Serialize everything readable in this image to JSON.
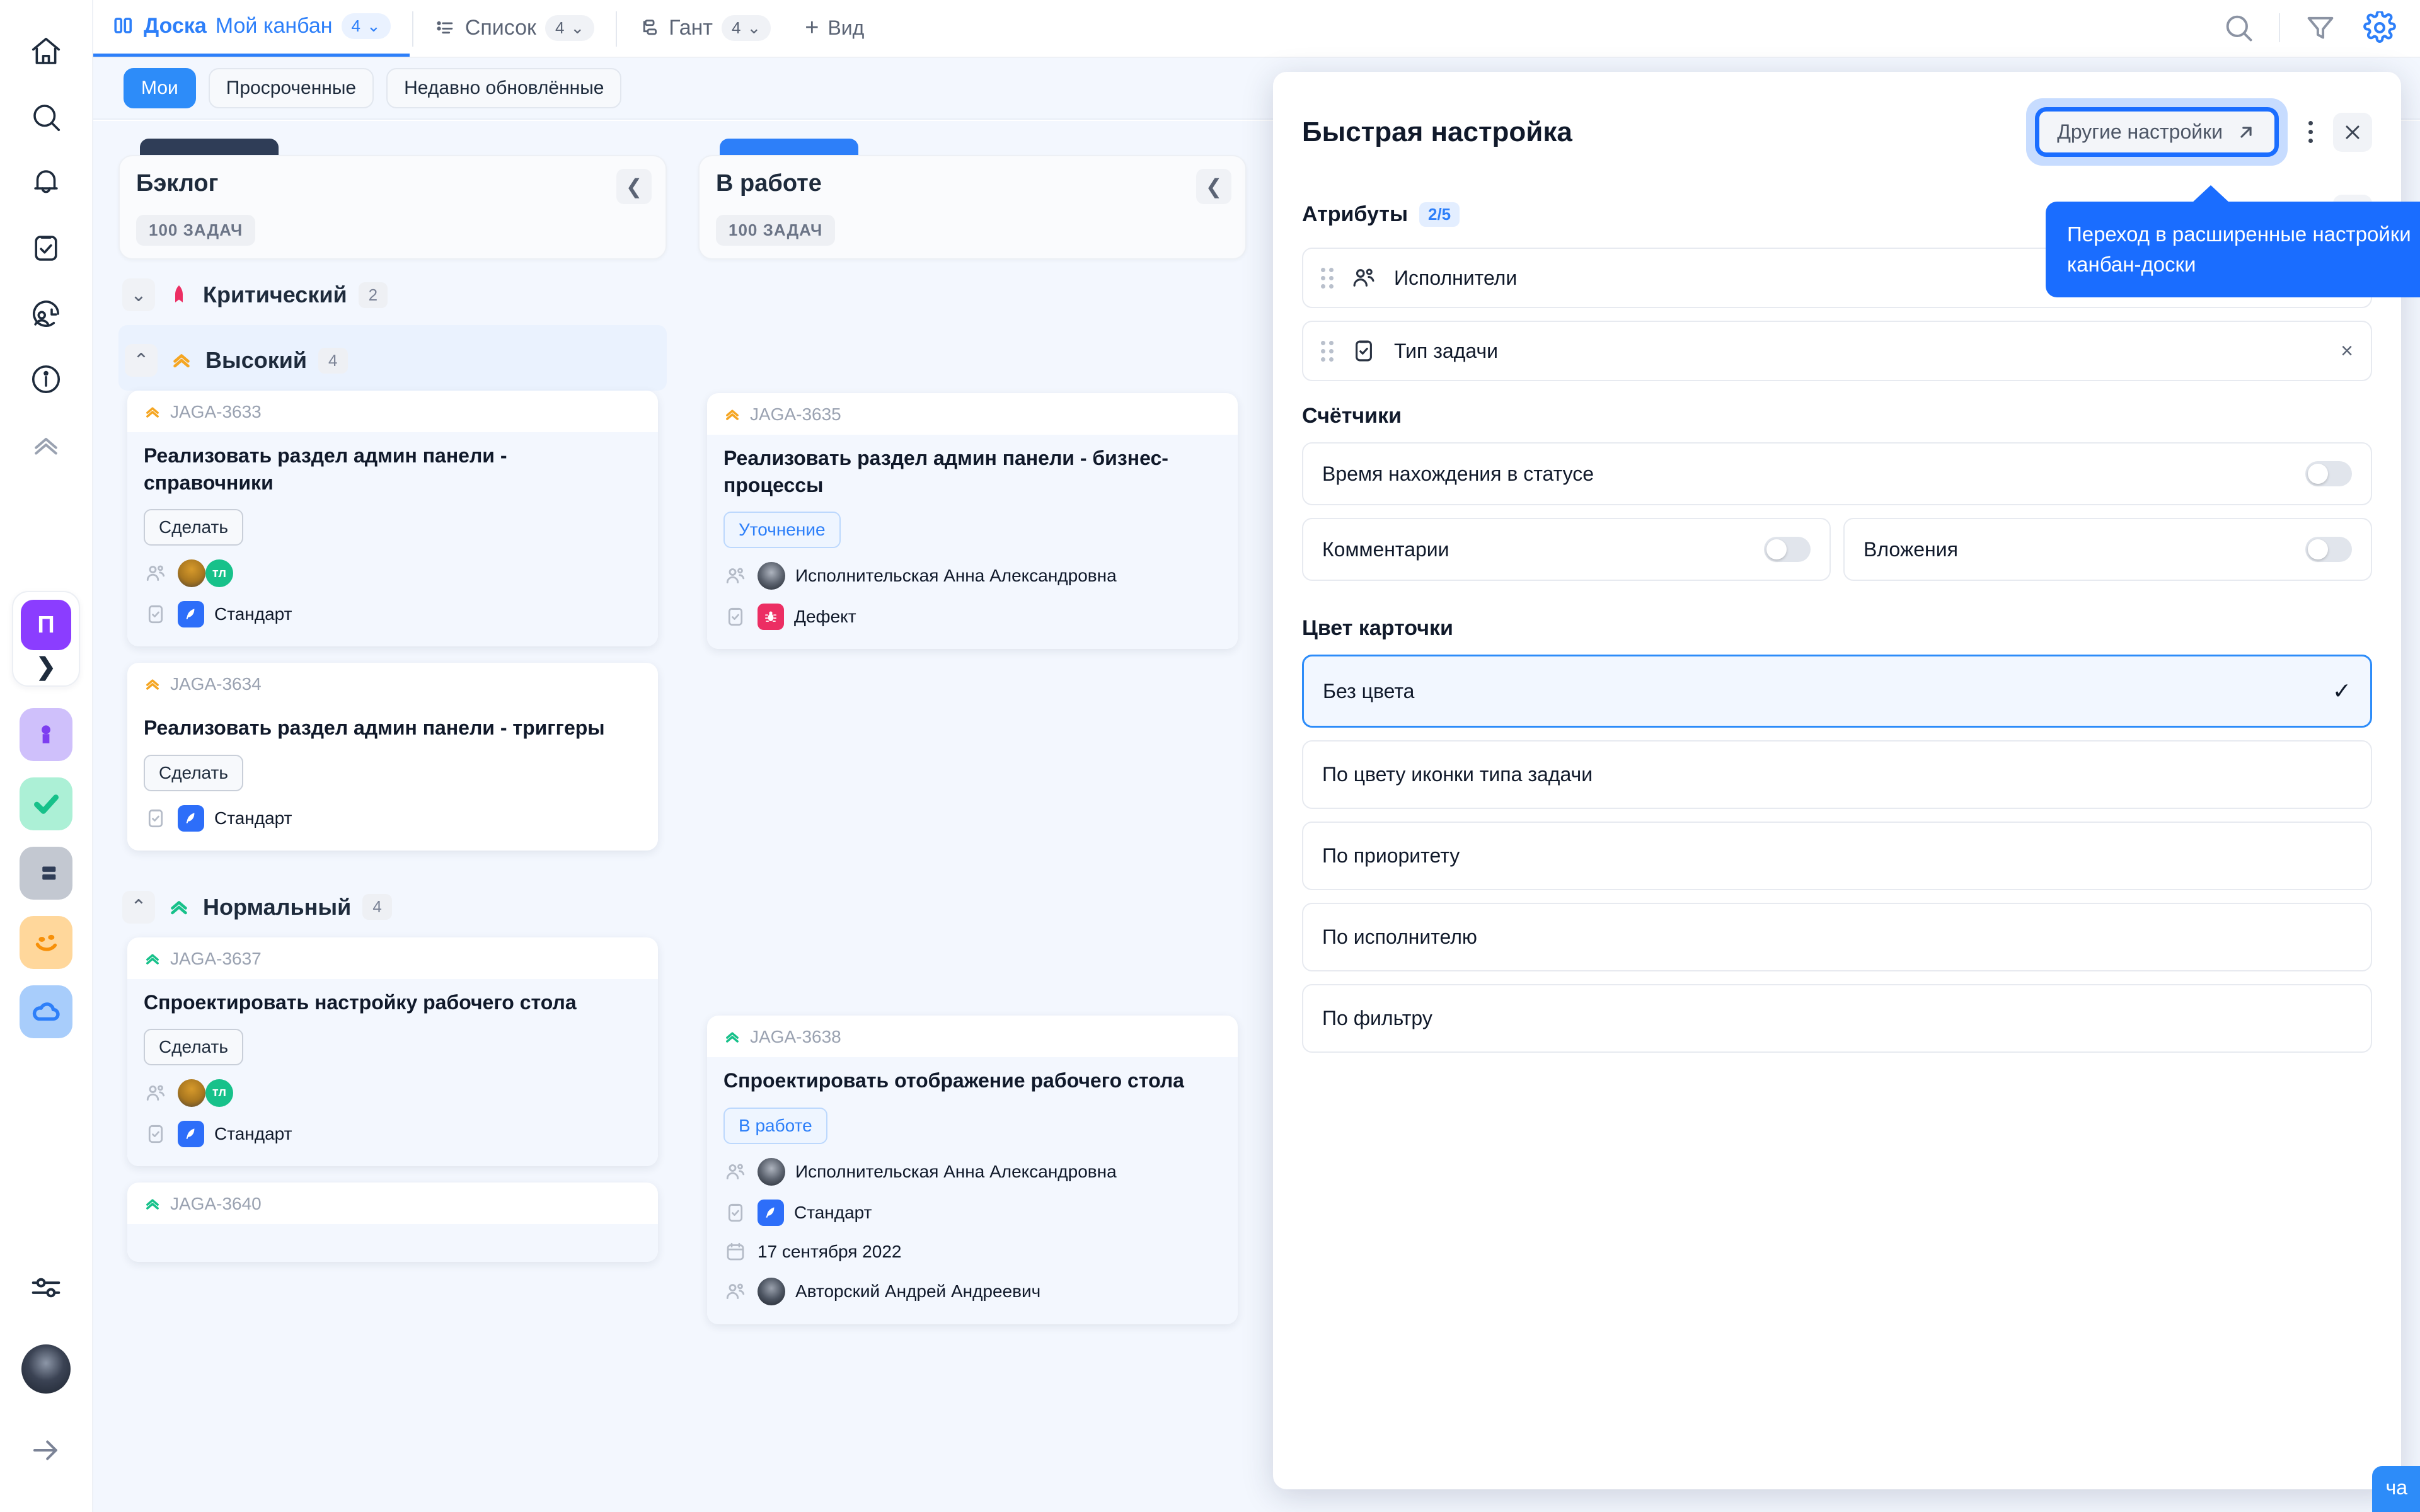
{
  "app": {
    "project_initial": "П",
    "accent": "#2d7ff9",
    "tooltip_blue": "#1a6dff"
  },
  "rail": {
    "icons": [
      {
        "name": "home-icon",
        "label": "Главная"
      },
      {
        "name": "search-icon",
        "label": "Поиск"
      },
      {
        "name": "bell-icon",
        "label": "Уведомления"
      },
      {
        "name": "tasks-icon",
        "label": "Мои задачи"
      },
      {
        "name": "time-tracking-icon",
        "label": "Учёт времени"
      },
      {
        "name": "info-icon",
        "label": "Справка"
      },
      {
        "name": "collapse-up-icon",
        "label": "Свернуть"
      }
    ],
    "apps": [
      {
        "name": "app-tile-person",
        "glyph": ""
      },
      {
        "name": "app-tile-check",
        "glyph": ""
      },
      {
        "name": "app-tile-board",
        "glyph": ""
      },
      {
        "name": "app-tile-smile",
        "glyph": ""
      },
      {
        "name": "app-tile-cloud",
        "glyph": ""
      }
    ],
    "bottom": [
      {
        "name": "sliders-icon",
        "label": "Настройки"
      },
      {
        "name": "avatar",
        "label": "Профиль"
      },
      {
        "name": "arrow-right-icon",
        "label": "Развернуть"
      }
    ]
  },
  "topbar": {
    "tabs": [
      {
        "prefix": "Доска",
        "name": "Мой канбан",
        "count": "4",
        "icon": "board-icon",
        "active": true
      },
      {
        "prefix": "Список",
        "name": "",
        "count": "4",
        "icon": "list-icon",
        "active": false
      },
      {
        "prefix": "Гант",
        "name": "",
        "count": "4",
        "icon": "gantt-icon",
        "active": false
      }
    ],
    "add_view": "Вид",
    "right_icons": [
      {
        "name": "search-icon"
      },
      {
        "name": "filter-icon"
      },
      {
        "name": "gear-icon"
      }
    ]
  },
  "chips": [
    {
      "label": "Мои",
      "active": true
    },
    {
      "label": "Просроченные",
      "active": false
    },
    {
      "label": "Недавно обновлённые",
      "active": false
    }
  ],
  "board": {
    "columns": [
      {
        "title": "Бэклог",
        "count_label": "100 ЗАДАЧ",
        "tab_color": "#2f3d57",
        "groups": [
          {
            "name": "Критический",
            "count": "2",
            "collapsed": true,
            "icon": "priority-critical-icon",
            "color": "#ec2e63",
            "cards": []
          },
          {
            "name": "Высокий",
            "count": "4",
            "collapsed": false,
            "icon": "priority-high-icon",
            "color": "#f5a623",
            "cards": [
              {
                "key": "JAGA-3633",
                "prio_color": "#f5a623",
                "title": "Реализовать раздел админ панели - справочники",
                "status": "Сделать",
                "status_style": "grey",
                "assignees_kind": "avatars",
                "assignee_text": "",
                "type": "Стандарт",
                "type_style": "std",
                "date": "",
                "author": ""
              },
              {
                "key": "JAGA-3634",
                "prio_color": "#f5a623",
                "title": "Реализовать раздел админ панели - триггеры",
                "status": "Сделать",
                "status_style": "grey",
                "assignees_kind": "none",
                "assignee_text": "",
                "type": "Стандарт",
                "type_style": "std",
                "date": "",
                "author": ""
              }
            ]
          },
          {
            "name": "Нормальный",
            "count": "4",
            "collapsed": false,
            "icon": "priority-normal-icon",
            "color": "#17c18a",
            "cards": [
              {
                "key": "JAGA-3637",
                "prio_color": "#17c18a",
                "title": "Спроектировать настройку рабочего стола",
                "status": "Сделать",
                "status_style": "grey",
                "assignees_kind": "avatars",
                "assignee_text": "",
                "type": "Стандарт",
                "type_style": "std",
                "date": "",
                "author": ""
              },
              {
                "key": "JAGA-3640",
                "prio_color": "#17c18a",
                "title": "",
                "status": "",
                "status_style": "grey",
                "assignees_kind": "none",
                "assignee_text": "",
                "type": "",
                "type_style": "std",
                "date": "",
                "author": ""
              }
            ]
          }
        ]
      },
      {
        "title": "В работе",
        "count_label": "100 ЗАДАЧ",
        "tab_color": "#2d7ff9",
        "groups": [
          {
            "name": "",
            "count": "",
            "collapsed": true,
            "icon": "",
            "color": "",
            "cards": []
          },
          {
            "name": "",
            "count": "",
            "collapsed": false,
            "icon": "",
            "color": "#f5a623",
            "cards": [
              {
                "key": "JAGA-3635",
                "prio_color": "#f5a623",
                "title": "Реализовать раздел админ панели - бизнес-процессы",
                "status": "Уточнение",
                "status_style": "blue",
                "assignees_kind": "named",
                "assignee_text": "Исполнительская Анна Александровна",
                "type": "Дефект",
                "type_style": "def",
                "date": "",
                "author": ""
              }
            ]
          },
          {
            "name": "",
            "count": "",
            "collapsed": false,
            "icon": "",
            "color": "#17c18a",
            "cards": [
              {
                "key": "JAGA-3638",
                "prio_color": "#17c18a",
                "title": "Спроектировать отображение рабочего стола",
                "status": "В работе",
                "status_style": "blue",
                "assignees_kind": "named",
                "assignee_text": "Исполнительская Анна Александровна",
                "type": "Стандарт",
                "type_style": "std",
                "date": "17 сентября 2022",
                "author": "Авторский Андрей Андреевич"
              }
            ]
          }
        ]
      }
    ]
  },
  "panel": {
    "title": "Быстрая настройка",
    "other_settings_label": "Другие настройки",
    "other_settings_icon": "external-link-icon",
    "kebab_icon": "more-vertical-icon",
    "close_icon": "close-icon",
    "edit_icon": "pencil-icon",
    "attributes": {
      "title": "Атрибуты",
      "badge": "2/5",
      "rows": [
        {
          "label": "Исполнители",
          "icon": "users-icon",
          "remove": "×"
        },
        {
          "label": "Тип задачи",
          "icon": "clipboard-check-icon",
          "remove": "×"
        }
      ]
    },
    "counters": {
      "title": "Счётчики",
      "rows": [
        {
          "label": "Время нахождения в статусе",
          "on": false,
          "wide": true
        },
        {
          "label": "Комментарии",
          "on": false,
          "wide": false
        },
        {
          "label": "Вложения",
          "on": false,
          "wide": false
        }
      ]
    },
    "card_color": {
      "title": "Цвет карточки",
      "options": [
        {
          "label": "Без цвета",
          "selected": true,
          "check": "✓"
        },
        {
          "label": "По цвету иконки типа задачи",
          "selected": false,
          "check": ""
        },
        {
          "label": "По приоритету",
          "selected": false,
          "check": ""
        },
        {
          "label": "По исполнителю",
          "selected": false,
          "check": ""
        },
        {
          "label": "По фильтру",
          "selected": false,
          "check": ""
        }
      ]
    }
  },
  "tooltip": {
    "text": "Переход в расширенные настройки канбан-доски"
  },
  "chat": {
    "label": "ча"
  }
}
